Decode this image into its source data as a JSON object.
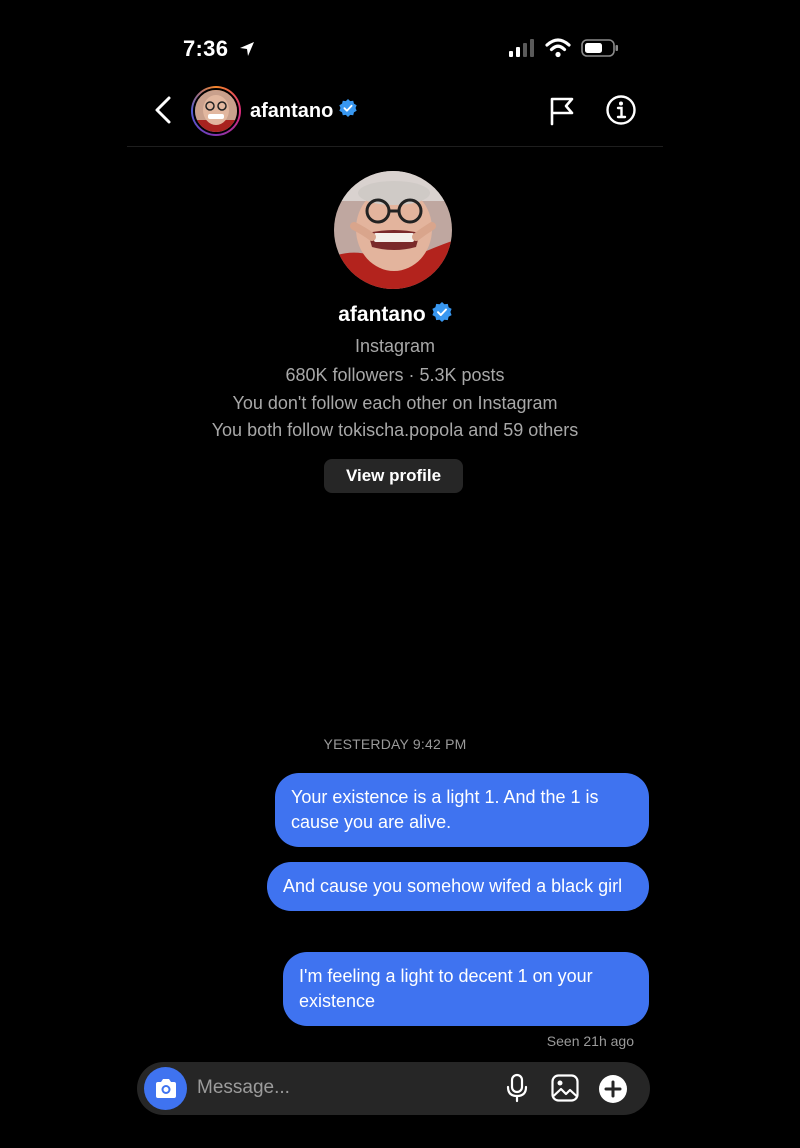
{
  "status_bar": {
    "time": "7:36"
  },
  "header": {
    "username": "afantano"
  },
  "profile": {
    "name": "afantano",
    "platform": "Instagram",
    "stats": "680K followers · 5.3K posts",
    "follow_status": "You don't follow each other on Instagram",
    "mutuals": "You both follow tokischa.popola and 59 others",
    "view_profile_label": "View profile"
  },
  "conversation": {
    "timestamp": "YESTERDAY 9:42 PM",
    "messages": [
      {
        "text": "Your existence is a light 1. And the 1 is cause you are alive."
      },
      {
        "text": "And cause you somehow wifed a black girl"
      },
      {
        "text": "I'm feeling a light to decent 1 on your existence"
      }
    ],
    "seen": "Seen 21h ago"
  },
  "composer": {
    "placeholder": "Message..."
  },
  "colors": {
    "bubble": "#3f73f0",
    "verified": "#3897f0",
    "background": "#000000",
    "composer": "#262626"
  }
}
